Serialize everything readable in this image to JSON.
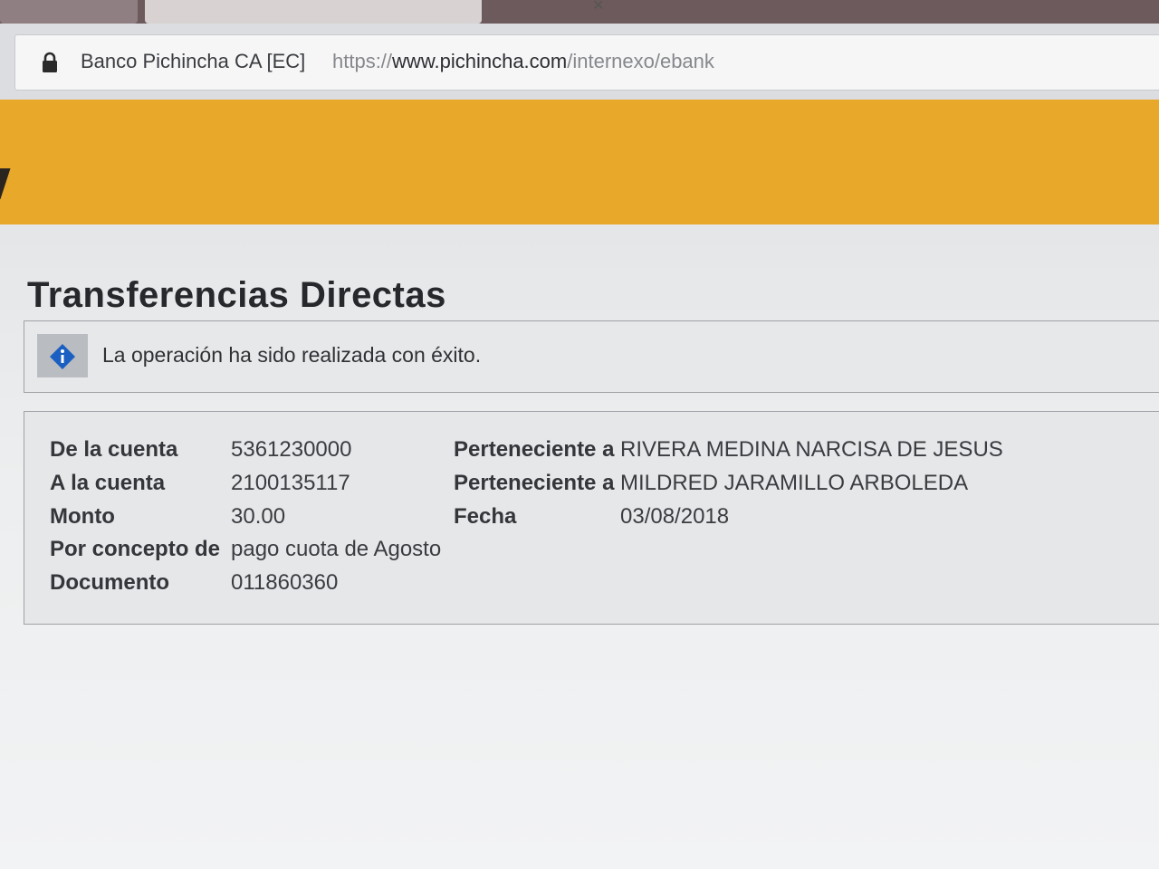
{
  "browser": {
    "site_name": "Banco Pichincha CA [EC]",
    "url_scheme": "https://",
    "url_host": "www.pichincha.com",
    "url_path": "/internexo/ebank"
  },
  "colors": {
    "brand_yellow": "#e8a82a",
    "title": "#26282b",
    "info_icon": "#1b5fc2"
  },
  "page": {
    "title": "Transferencias Directas",
    "message": "La operación ha sido realizada con éxito."
  },
  "details": {
    "from_label": "De la cuenta",
    "from_value": "5361230000",
    "to_label": "A la cuenta",
    "to_value": "2100135117",
    "amount_label": "Monto",
    "amount_value": "30.00",
    "concept_label": "Por concepto de",
    "concept_value": "pago cuota de Agosto",
    "document_label": "Documento",
    "document_value": "011860360",
    "owner_label_1": "Perteneciente a",
    "owner_value_1": "RIVERA MEDINA NARCISA DE JESUS",
    "owner_label_2": "Perteneciente a",
    "owner_value_2": "MILDRED JARAMILLO ARBOLEDA",
    "date_label": "Fecha",
    "date_value": "03/08/2018"
  }
}
